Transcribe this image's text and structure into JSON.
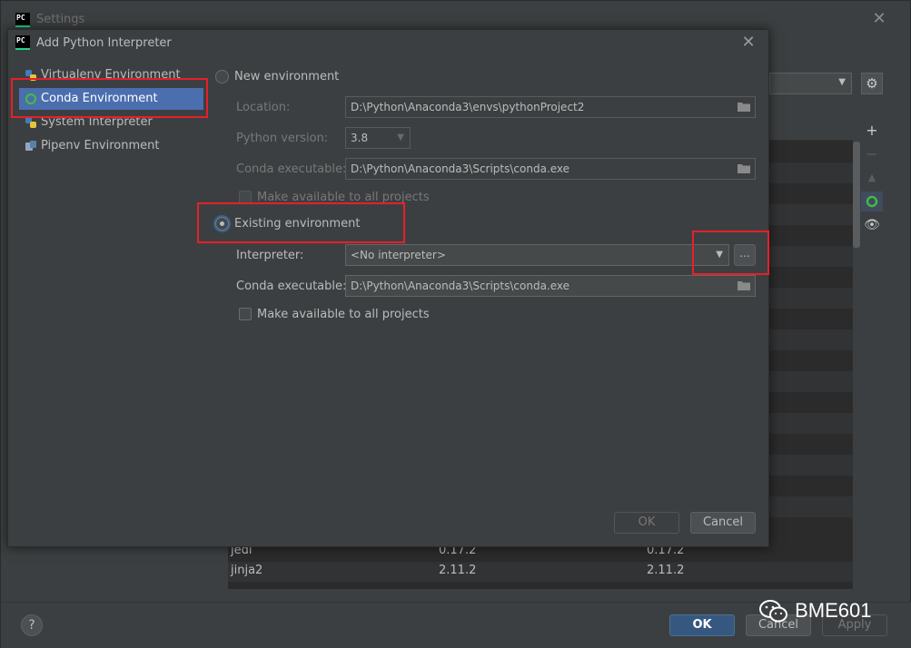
{
  "settings": {
    "title": "Settings",
    "footer": {
      "help": "?",
      "ok": "OK",
      "cancel": "Cancel",
      "apply": "Apply"
    }
  },
  "packages": [
    {
      "name": "jedi",
      "version": "0.17.2",
      "latest": "0.17.2"
    },
    {
      "name": "jinja2",
      "version": "2.11.2",
      "latest": "2.11.2"
    }
  ],
  "dialog": {
    "title": "Add Python Interpreter",
    "env_types": [
      {
        "label": "Virtualenv Environment",
        "icon": "python-virtualenv-icon"
      },
      {
        "label": "Conda Environment",
        "icon": "conda-icon"
      },
      {
        "label": "System Interpreter",
        "icon": "python-icon"
      },
      {
        "label": "Pipenv Environment",
        "icon": "pipenv-icon"
      }
    ],
    "new_env": {
      "label": "New environment",
      "location_label": "Location:",
      "location_value": "D:\\Python\\Anaconda3\\envs\\pythonProject2",
      "python_version_label": "Python version:",
      "python_version_value": "3.8",
      "conda_exec_label": "Conda executable:",
      "conda_exec_value": "D:\\Python\\Anaconda3\\Scripts\\conda.exe",
      "make_available_label": "Make available to all projects"
    },
    "existing_env": {
      "label": "Existing environment",
      "interpreter_label": "Interpreter:",
      "interpreter_value": "<No interpreter>",
      "browse_label": "...",
      "conda_exec_label": "Conda executable:",
      "conda_exec_value": "D:\\Python\\Anaconda3\\Scripts\\conda.exe",
      "make_available_label": "Make available to all projects"
    },
    "ok": "OK",
    "cancel": "Cancel"
  },
  "watermark": "BME601",
  "colors": {
    "highlight_box": "#e6202a",
    "selection": "#4b6eaf",
    "primary_button": "#365880"
  }
}
